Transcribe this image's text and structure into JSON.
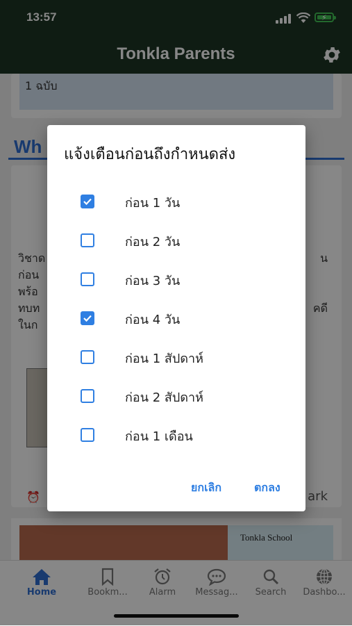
{
  "status": {
    "time": "13:57"
  },
  "app": {
    "title": "Tonkla Parents"
  },
  "background": {
    "top_card_text": "1 ฉบับ",
    "section_title": "Wh",
    "body_lines": [
      "วิชาด",
      "ก่อน",
      "พร้อ",
      "ทบท",
      "ในก"
    ],
    "body_right": [
      "น",
      "คดี"
    ],
    "bookmark_partial": "ark",
    "school_name": "Tonkla School"
  },
  "dialog": {
    "title": "แจ้งเตือนก่อนถึงกำหนดส่ง",
    "options": [
      {
        "label": "ก่อน 1 วัน",
        "checked": true
      },
      {
        "label": "ก่อน 2 วัน",
        "checked": false
      },
      {
        "label": "ก่อน 3 วัน",
        "checked": false
      },
      {
        "label": "ก่อน 4 วัน",
        "checked": true
      },
      {
        "label": "ก่อน 1 สัปดาห์",
        "checked": false
      },
      {
        "label": "ก่อน 2 สัปดาห์",
        "checked": false
      },
      {
        "label": "ก่อน 1 เดือน",
        "checked": false
      }
    ],
    "cancel_label": "ยกเลิก",
    "ok_label": "ตกลง"
  },
  "nav": {
    "items": [
      {
        "label": "Home",
        "icon": "home-icon",
        "active": true
      },
      {
        "label": "Bookm...",
        "icon": "bookmark-icon",
        "active": false
      },
      {
        "label": "Alarm",
        "icon": "alarm-icon",
        "active": false
      },
      {
        "label": "Messag...",
        "icon": "message-icon",
        "active": false
      },
      {
        "label": "Search",
        "icon": "search-icon",
        "active": false
      },
      {
        "label": "Dashbo...",
        "icon": "globe-icon",
        "active": false
      }
    ]
  },
  "colors": {
    "accent": "#2f7fe2",
    "appbar": "#1d3524",
    "section": "#2f6ed2"
  }
}
